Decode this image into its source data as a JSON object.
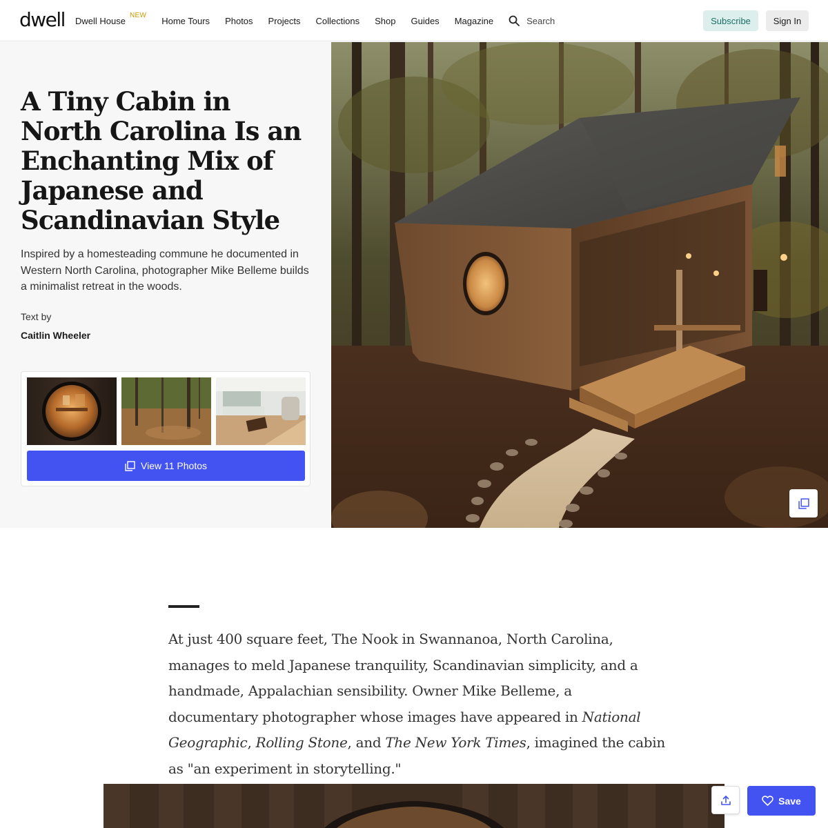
{
  "header": {
    "logo": "dwell",
    "nav": [
      {
        "label": "Dwell House",
        "badge": "NEW"
      },
      {
        "label": "Home Tours"
      },
      {
        "label": "Photos"
      },
      {
        "label": "Projects"
      },
      {
        "label": "Collections"
      },
      {
        "label": "Shop"
      },
      {
        "label": "Guides"
      },
      {
        "label": "Magazine"
      }
    ],
    "search_label": "Search",
    "subscribe_label": "Subscribe",
    "signin_label": "Sign In"
  },
  "hero": {
    "title": "A Tiny Cabin in North Carolina Is an Enchanting Mix of Japanese and Scandinavian Style",
    "dek": "Inspired by a homesteading commune he documented in Western North Carolina, photographer Mike Belleme builds a minimalist retreat in the woods.",
    "byline_label": "Text by",
    "byline_name": "Caitlin Wheeler",
    "view_photos_label": "View 11 Photos"
  },
  "article": {
    "p1_a": "At just 400 square feet, The Nook in Swannanoa, North Carolina, manages to meld Japanese tranquility, Scandinavian simplicity, and a handmade, Appalachian sensibility. Owner Mike Belleme, a documentary photographer whose images have appeared in ",
    "p1_pub1": "National Geographic",
    "p1_sep1": ", ",
    "p1_pub2": "Rolling Stone",
    "p1_sep2": ", and ",
    "p1_pub3": "The New York Times",
    "p1_b": ", imagined the cabin as \"an experiment in storytelling.\""
  },
  "actions": {
    "save_label": "Save"
  },
  "colors": {
    "accent": "#4353f2",
    "subscribe_bg": "#dcefed",
    "subscribe_text": "#1b6e66",
    "badge": "#c79a00"
  }
}
